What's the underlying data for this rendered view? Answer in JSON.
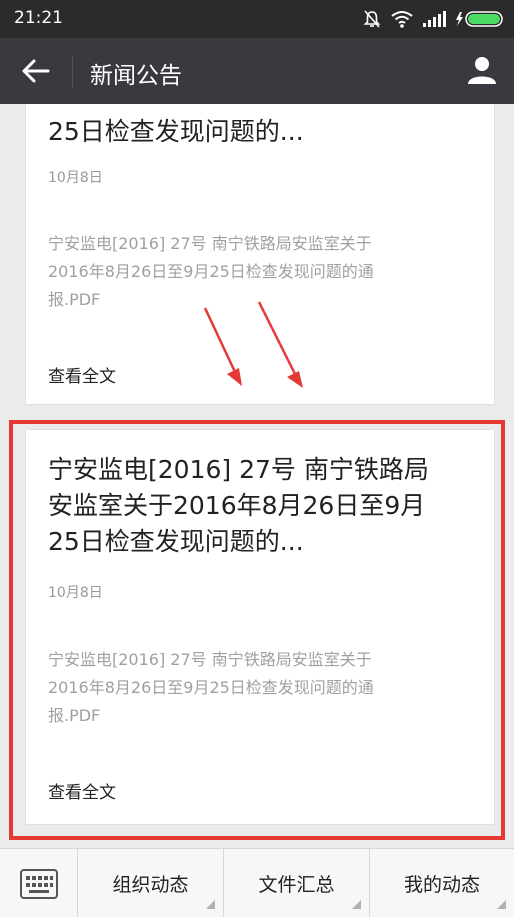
{
  "status_bar": {
    "time": "21:21"
  },
  "app_bar": {
    "title": "新闻公告"
  },
  "cards": [
    {
      "title_line3": "25日检查发现问题的...",
      "date": "10月8日",
      "excerpt_lines": [
        "宁安监电[2016] 27号 南宁铁路局安监室关于",
        "2016年8月26日至9月25日检查发现问题的通",
        "报.PDF"
      ],
      "read_more": "查看全文"
    },
    {
      "title_lines": [
        "宁安监电[2016] 27号 南宁铁路局",
        "安监室关于2016年8月26日至9月",
        "25日检查发现问题的..."
      ],
      "date": "10月8日",
      "excerpt_lines": [
        "宁安监电[2016] 27号 南宁铁路局安监室关于",
        "2016年8月26日至9月25日检查发现问题的通",
        "报.PDF"
      ],
      "read_more": "查看全文"
    }
  ],
  "bottom_menu": [
    {
      "label": "组织动态"
    },
    {
      "label": "文件汇总"
    },
    {
      "label": "我的动态"
    }
  ],
  "colors": {
    "status_bar": "#2b2b2b",
    "app_bar": "#393a3f",
    "highlight": "#e53935",
    "arrow": "#e53935",
    "battery": "#4cd964"
  },
  "icons": [
    "mute-bell-icon",
    "wifi-icon",
    "signal-icon",
    "battery-icon",
    "back-arrow-icon",
    "user-icon",
    "keyboard-icon",
    "red-arrow-icon"
  ]
}
